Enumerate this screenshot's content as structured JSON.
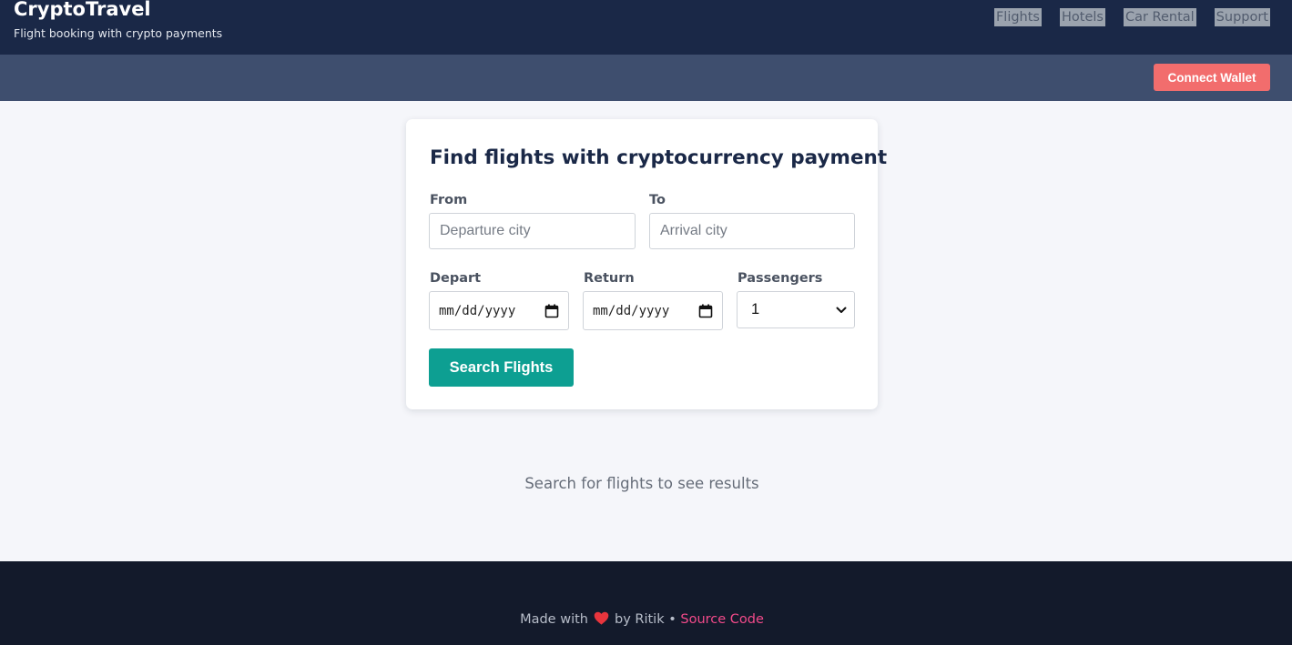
{
  "header": {
    "title": "CryptoTravel",
    "subtitle": "Flight booking with crypto payments",
    "nav": [
      "Flights",
      "Hotels",
      "Car Rental",
      "Support"
    ],
    "connect_wallet_label": "Connect Wallet"
  },
  "search_form": {
    "heading": "Find flights with cryptocurrency payment",
    "from": {
      "label": "From",
      "placeholder": "Departure city",
      "value": ""
    },
    "to": {
      "label": "To",
      "placeholder": "Arrival city",
      "value": ""
    },
    "depart": {
      "label": "Depart",
      "value": "mm/dd/yyyy"
    },
    "return": {
      "label": "Return",
      "value": "mm/dd/yyyy"
    },
    "passengers": {
      "label": "Passengers",
      "selected": "1"
    },
    "submit_label": "Search Flights"
  },
  "results": {
    "empty_message": "Search for flights to see results"
  },
  "footer": {
    "made_with": "Made with",
    "heart_icon": "heart-icon",
    "by_text": "by Ritik •",
    "link_text": "Source Code"
  },
  "colors": {
    "header_bg": "#1a2847",
    "subbar_bg": "#3e4e6e",
    "wallet_button": "#f26d6d",
    "search_button": "#0d9f92",
    "footer_bg": "#131a2b",
    "link": "#f24a8a",
    "heart": "#e8353d"
  }
}
